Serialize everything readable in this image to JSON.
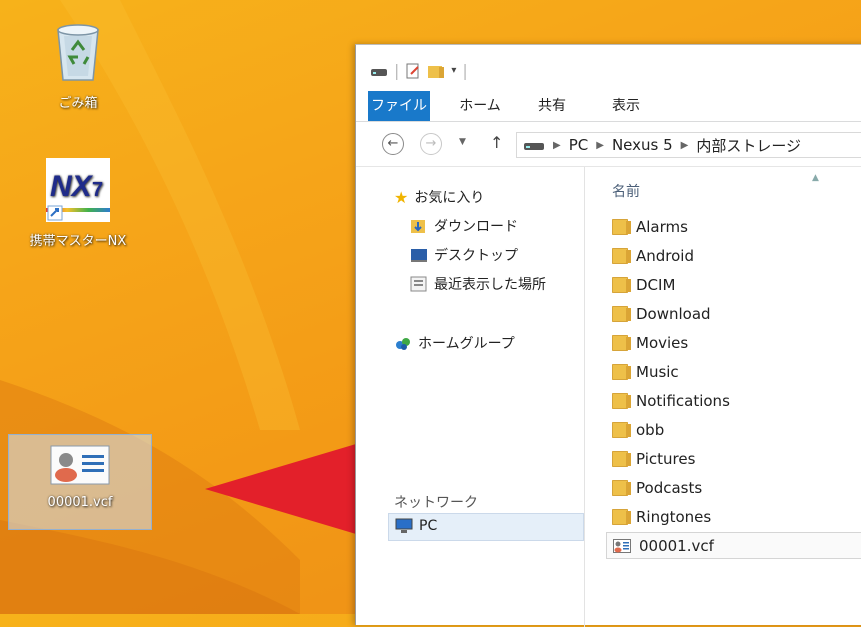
{
  "desktop": {
    "icons": [
      {
        "label": "ごみ箱",
        "icon": "recycle-bin-icon"
      },
      {
        "label": "携帯マスターNX",
        "icon": "nx7-app-icon",
        "logo_text": "NX7"
      },
      {
        "label": "00001.vcf",
        "icon": "vcard-icon"
      }
    ]
  },
  "explorer": {
    "ribbon_tabs": [
      "ファイル",
      "ホーム",
      "共有",
      "表示"
    ],
    "breadcrumb": [
      "PC",
      "Nexus 5",
      "内部ストレージ"
    ],
    "nav": {
      "favorites": "お気に入り",
      "downloads": "ダウンロード",
      "desktop": "デスクトップ",
      "recent": "最近表示した場所",
      "homegroup": "ホームグループ",
      "pc": "PC",
      "network": "ネットワーク"
    },
    "column_header": "名前",
    "files": [
      {
        "name": "Alarms",
        "type": "folder"
      },
      {
        "name": "Android",
        "type": "folder"
      },
      {
        "name": "DCIM",
        "type": "folder"
      },
      {
        "name": "Download",
        "type": "folder"
      },
      {
        "name": "Movies",
        "type": "folder"
      },
      {
        "name": "Music",
        "type": "folder"
      },
      {
        "name": "Notifications",
        "type": "folder"
      },
      {
        "name": "obb",
        "type": "folder"
      },
      {
        "name": "Pictures",
        "type": "folder"
      },
      {
        "name": "Podcasts",
        "type": "folder"
      },
      {
        "name": "Ringtones",
        "type": "folder"
      },
      {
        "name": "00001.vcf",
        "type": "vcard"
      }
    ]
  },
  "colors": {
    "arrow": "#e3202a",
    "ribbon_file_tab": "#1979ca",
    "desktop": "#f6a519"
  }
}
